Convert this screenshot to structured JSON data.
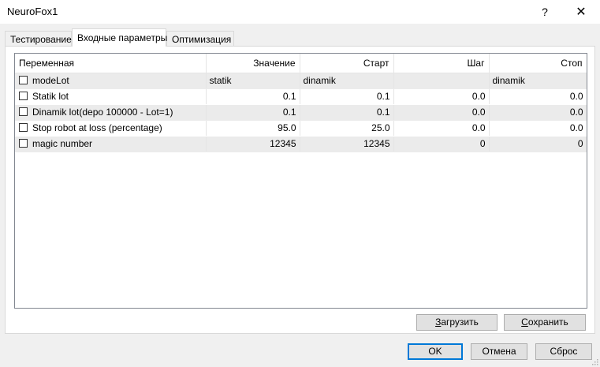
{
  "window": {
    "title": "NeuroFox1",
    "help_label": "?",
    "close_label": "✕"
  },
  "tabs": [
    {
      "label": "Тестирование"
    },
    {
      "label": "Входные параметры"
    },
    {
      "label": "Оптимизация"
    }
  ],
  "grid": {
    "columns": [
      "Переменная",
      "Значение",
      "Старт",
      "Шаг",
      "Стоп"
    ],
    "rows": [
      {
        "name": "modeLot",
        "value": "statik",
        "start": "dinamik",
        "step": "",
        "stop": "dinamik",
        "checked": false
      },
      {
        "name": "Statik lot",
        "value": "0.1",
        "start": "0.1",
        "step": "0.0",
        "stop": "0.0",
        "checked": false
      },
      {
        "name": "Dinamik lot(depo 100000 - Lot=1)",
        "value": "0.1",
        "start": "0.1",
        "step": "0.0",
        "stop": "0.0",
        "checked": false
      },
      {
        "name": "Stop robot at loss (percentage)",
        "value": "95.0",
        "start": "25.0",
        "step": "0.0",
        "stop": "0.0",
        "checked": false
      },
      {
        "name": "magic number",
        "value": "12345",
        "start": "12345",
        "step": "0",
        "stop": "0",
        "checked": false
      }
    ]
  },
  "buttons": {
    "load_mnemonic": "З",
    "load_rest": "агрузить",
    "save_mnemonic": "С",
    "save_rest": "охранить",
    "ok": "OK",
    "cancel": "Отмена",
    "reset": "Сброс"
  },
  "colors": {
    "accent": "#0078d7",
    "row_alt": "#ebebeb"
  }
}
